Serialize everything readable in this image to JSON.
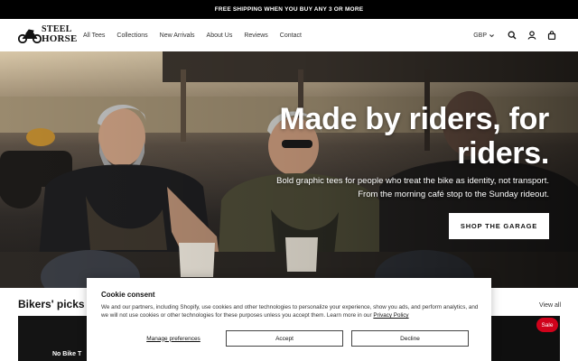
{
  "announcement": "FREE SHIPPING WHEN YOU BUY ANY 3 OR MORE",
  "logo": {
    "line1": "STEEL",
    "line2": "HORSE"
  },
  "nav": [
    {
      "label": "All Tees"
    },
    {
      "label": "Collections"
    },
    {
      "label": "New Arrivals"
    },
    {
      "label": "About Us"
    },
    {
      "label": "Reviews"
    },
    {
      "label": "Contact"
    }
  ],
  "header": {
    "currency": "GBP",
    "icons": [
      "search-icon",
      "account-icon",
      "cart-icon"
    ]
  },
  "hero": {
    "title": "Made by riders, for riders.",
    "subtitle_line1": "Bold graphic tees for people who treat the bike as identity, not transport.",
    "subtitle_line2": "From the morning café stop to the Sunday rideout.",
    "cta": "SHOP THE GARAGE"
  },
  "collection": {
    "title": "Bikers' picks",
    "view_all": "View all",
    "card_text": "No Bike T",
    "badge": "Sale"
  },
  "cookie": {
    "title": "Cookie consent",
    "text": "We and our partners, including Shopify, use cookies and other technologies to personalize your experience, show you ads, and perform analytics, and we will not use cookies or other technologies for these purposes unless you accept them. Learn more in our",
    "policy_link": "Privacy Policy",
    "manage": "Manage preferences",
    "accept": "Accept",
    "decline": "Decline"
  },
  "colors": {
    "announce_bg": "#000000",
    "sale_badge": "#d0021b",
    "button_bg": "#ffffff"
  }
}
